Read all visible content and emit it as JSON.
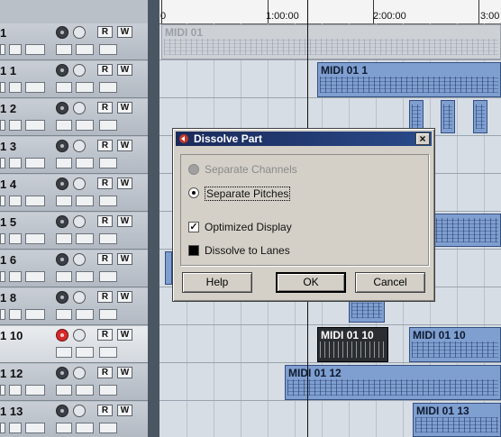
{
  "ruler": {
    "labels": [
      "0",
      "1:00:00",
      "2:00:00",
      "3:00"
    ]
  },
  "tracks": [
    {
      "name": "1",
      "rec": false,
      "selected": false
    },
    {
      "name": "1 1",
      "rec": false,
      "selected": false
    },
    {
      "name": "1 2",
      "rec": false,
      "selected": false
    },
    {
      "name": "1 3",
      "rec": false,
      "selected": false
    },
    {
      "name": "1 4",
      "rec": false,
      "selected": false
    },
    {
      "name": "1 5",
      "rec": false,
      "selected": false
    },
    {
      "name": "1 6",
      "rec": false,
      "selected": false
    },
    {
      "name": "1 8",
      "rec": false,
      "selected": false
    },
    {
      "name": "1 10",
      "rec": true,
      "selected": true
    },
    {
      "name": "1 12",
      "rec": false,
      "selected": false
    },
    {
      "name": "1 13",
      "rec": false,
      "selected": false
    }
  ],
  "track_buttons": {
    "read": "R",
    "write": "W"
  },
  "parts": {
    "p0": "MIDI 01",
    "p1": "MIDI 01 1",
    "p8a": "MIDI 01 10",
    "p8b": "MIDI 01 10",
    "p9": "MIDI 01 12",
    "p10": "MIDI 01 13"
  },
  "dialog": {
    "title": "Dissolve Part",
    "close": "×",
    "options": {
      "separate_channels": "Separate Channels",
      "separate_pitches": "Separate Pitches",
      "optimized_display": "Optimized Display",
      "dissolve_to_lanes": "Dissolve to Lanes"
    },
    "state": {
      "separate_channels": "disabled",
      "separate_pitches": "selected",
      "optimized_display": true,
      "dissolve_to_lanes": false
    },
    "buttons": {
      "help": "Help",
      "ok": "OK",
      "cancel": "Cancel"
    }
  },
  "colors": {
    "part": "#7f9fd0",
    "selected_part": "#2a2d31",
    "record": "#d62b2b"
  }
}
